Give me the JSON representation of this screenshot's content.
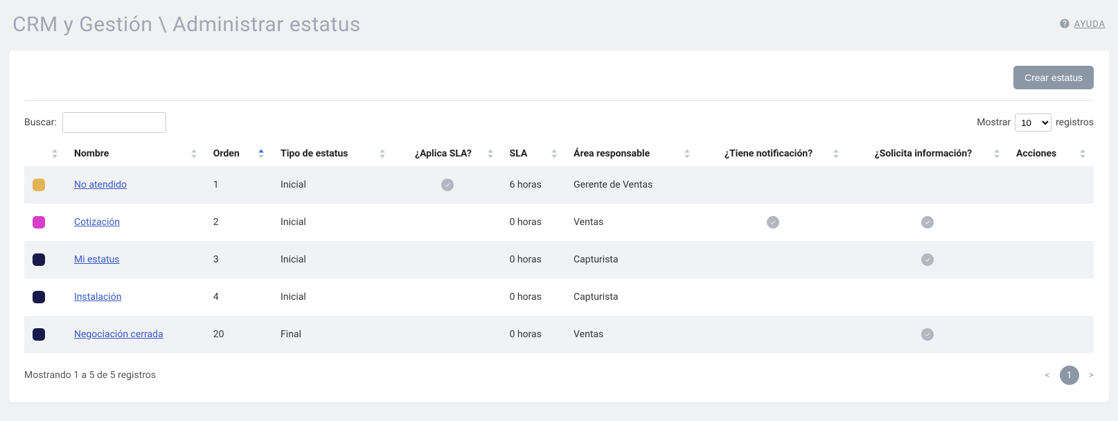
{
  "header": {
    "breadcrumb": "CRM y Gestión \\ Administrar estatus",
    "help_label": "AYUDA"
  },
  "toolbar": {
    "create_label": "Crear estatus"
  },
  "search": {
    "label": "Buscar:",
    "value": ""
  },
  "length": {
    "prefix": "Mostrar",
    "suffix": "registros",
    "selected": "10",
    "options": [
      "10",
      "25",
      "50",
      "100"
    ]
  },
  "columns": {
    "color": "",
    "nombre": "Nombre",
    "orden": "Orden",
    "tipo": "Tipo de estatus",
    "aplica_sla": "¿Aplica SLA?",
    "sla": "SLA",
    "area": "Área responsable",
    "notif": "¿Tiene notificación?",
    "solicita": "¿Solicita información?",
    "acciones": "Acciones"
  },
  "rows": [
    {
      "color": "#e3b456",
      "nombre": "No atendido",
      "orden": "1",
      "tipo": "Inicial",
      "aplica_sla": true,
      "sla": "6 horas",
      "area": "Gerente de Ventas",
      "notif": false,
      "solicita": false
    },
    {
      "color": "#d93ecb",
      "nombre": "Cotización",
      "orden": "2",
      "tipo": "Inicial",
      "aplica_sla": false,
      "sla": "0 horas",
      "area": "Ventas",
      "notif": true,
      "solicita": true
    },
    {
      "color": "#171a4a",
      "nombre": "Mi estatus",
      "orden": "3",
      "tipo": "Inicial",
      "aplica_sla": false,
      "sla": "0 horas",
      "area": "Capturista",
      "notif": false,
      "solicita": true
    },
    {
      "color": "#171a4a",
      "nombre": "Instalación",
      "orden": "4",
      "tipo": "Inicial",
      "aplica_sla": false,
      "sla": "0 horas",
      "area": "Capturista",
      "notif": false,
      "solicita": false
    },
    {
      "color": "#171a4a",
      "nombre": "Negociación cerrada",
      "orden": "20",
      "tipo": "Final",
      "aplica_sla": false,
      "sla": "0 horas",
      "area": "Ventas",
      "notif": false,
      "solicita": true
    }
  ],
  "info": "Mostrando 1 a 5 de 5 registros",
  "pager": {
    "prev": "<",
    "next": ">",
    "current": "1"
  }
}
